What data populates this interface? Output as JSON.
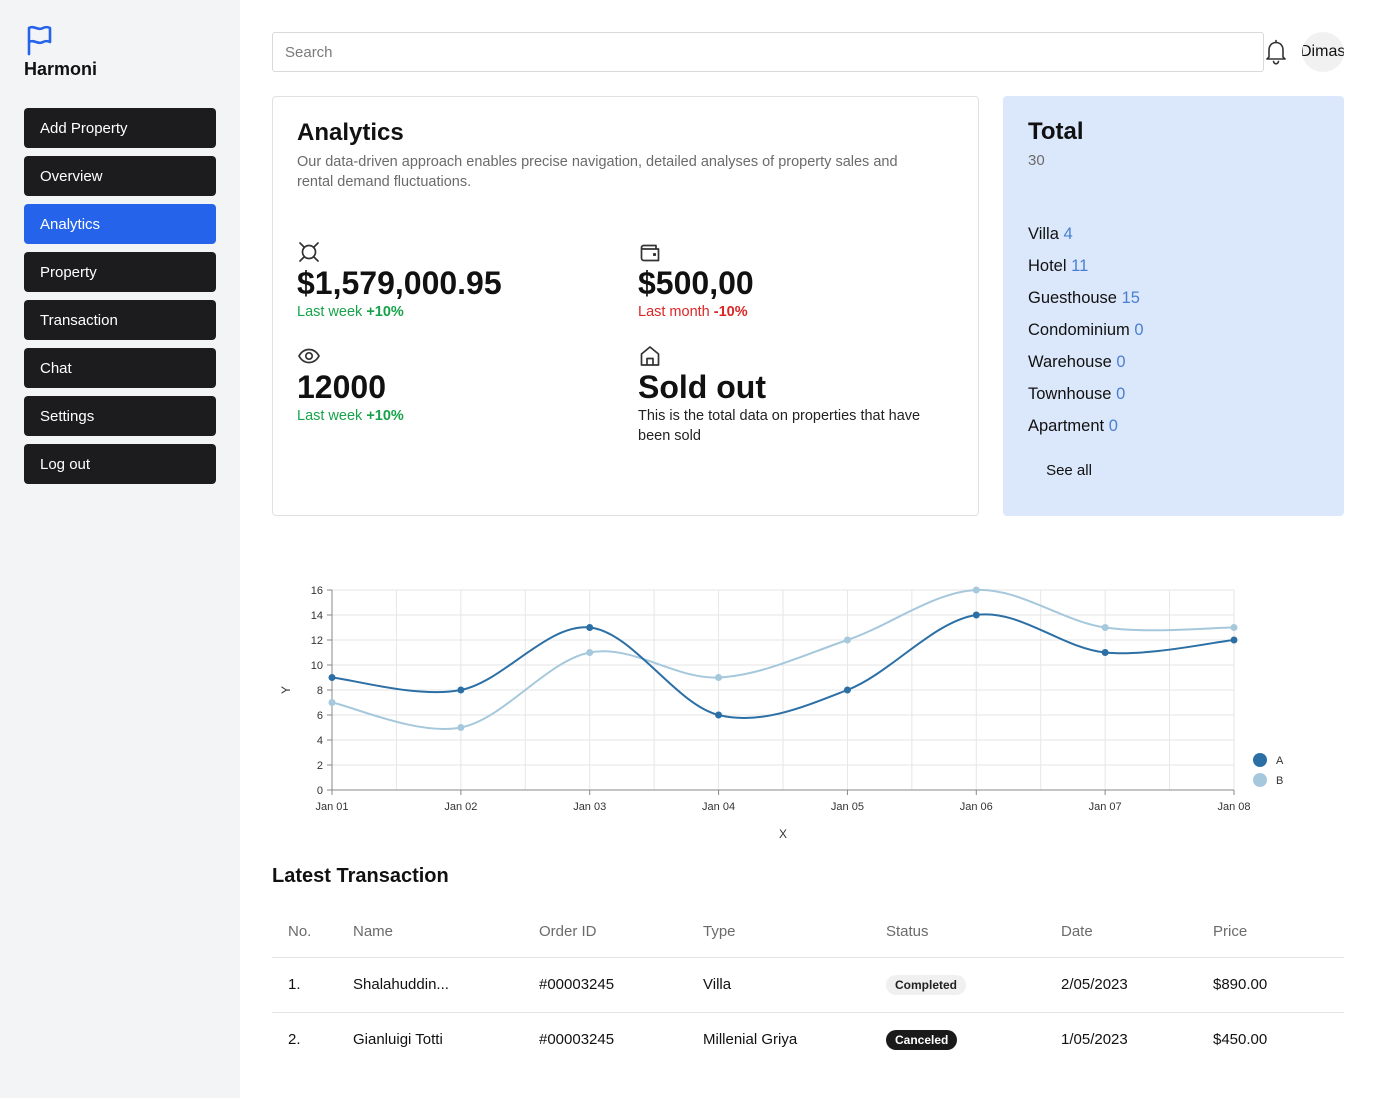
{
  "brand": {
    "name": "Harmoni",
    "icon": "flag-icon"
  },
  "sidebar": {
    "items": [
      {
        "label": "Add Property",
        "active": false
      },
      {
        "label": "Overview",
        "active": false
      },
      {
        "label": "Analytics",
        "active": true
      },
      {
        "label": "Property",
        "active": false
      },
      {
        "label": "Transaction",
        "active": false
      },
      {
        "label": "Chat",
        "active": false
      },
      {
        "label": "Settings",
        "active": false
      },
      {
        "label": "Log out",
        "active": false
      }
    ]
  },
  "header": {
    "search_placeholder": "Search",
    "user_name": "Dimas",
    "notification_icon": "bell-icon"
  },
  "analytics": {
    "title": "Analytics",
    "description": "Our data-driven approach enables precise navigation, detailed analyses of property sales and rental demand fluctuations.",
    "stats": [
      {
        "icon": "coin-icon",
        "value": "$1,579,000.95",
        "period": "Last week",
        "change": "+10%"
      },
      {
        "icon": "wallet-icon",
        "value": "$500,00",
        "period": "Last month",
        "change": "-10%"
      },
      {
        "icon": "eye-icon",
        "value": "12000",
        "period": "Last week",
        "change": "+10%"
      },
      {
        "icon": "home-icon",
        "value": "Sold out",
        "note": "This is the total data on properties that have been sold"
      }
    ]
  },
  "total": {
    "title": "Total",
    "count": "30",
    "items": [
      {
        "label": "Villa",
        "count": "4"
      },
      {
        "label": "Hotel",
        "count": "11"
      },
      {
        "label": "Guesthouse",
        "count": "15"
      },
      {
        "label": "Condominium",
        "count": "0"
      },
      {
        "label": "Warehouse",
        "count": "0"
      },
      {
        "label": "Townhouse",
        "count": "0"
      },
      {
        "label": "Apartment",
        "count": "0"
      }
    ],
    "see_all_label": "See all"
  },
  "chart_data": {
    "type": "line",
    "x": [
      "Jan 01",
      "Jan 02",
      "Jan 03",
      "Jan 04",
      "Jan 05",
      "Jan 06",
      "Jan 07",
      "Jan 08"
    ],
    "series": [
      {
        "name": "A",
        "values": [
          9,
          8,
          13,
          6,
          8,
          14,
          11,
          12
        ],
        "color": "#2c6fa5"
      },
      {
        "name": "B",
        "values": [
          7,
          5,
          11,
          9,
          12,
          16,
          13,
          13
        ],
        "color": "#a6c8dc"
      }
    ],
    "xlabel": "X",
    "ylabel": "Y",
    "ylim": [
      0,
      16
    ],
    "yticks": [
      0,
      2,
      4,
      6,
      8,
      10,
      12,
      14,
      16
    ],
    "grid": true,
    "legend": "right"
  },
  "transactions": {
    "title": "Latest Transaction",
    "columns": [
      "No.",
      "Name",
      "Order ID",
      "Type",
      "Status",
      "Date",
      "Price"
    ],
    "rows": [
      {
        "no": "1.",
        "name": "Shalahuddin...",
        "order_id": "#00003245",
        "type": "Villa",
        "status": "Completed",
        "date": "2/05/2023",
        "price": "$890.00"
      },
      {
        "no": "2.",
        "name": "Gianluigi Totti",
        "order_id": "#00003245",
        "type": "Millenial Griya",
        "status": "Canceled",
        "date": "1/05/2023",
        "price": "$450.00"
      }
    ]
  }
}
